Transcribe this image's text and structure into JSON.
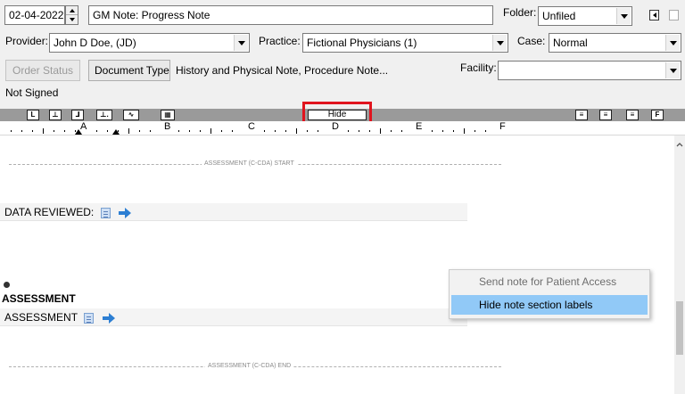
{
  "header": {
    "date": "02-04-2022",
    "note_title": "GM Note: Progress Note",
    "folder_label": "Folder:",
    "folder_value": "Unfiled",
    "provider_label": "Provider:",
    "provider_value": "John D Doe, (JD)",
    "practice_label": "Practice:",
    "practice_value": "Fictional Physicians (1)",
    "case_label": "Case:",
    "case_value": "Normal",
    "order_status_label": "Order Status",
    "document_type_label": "Document Type",
    "document_type_value": "History and Physical Note, Procedure Note...",
    "facility_label": "Facility:",
    "facility_value": "",
    "sign_status": "Not Signed"
  },
  "toolbar": {
    "hide_label": "Hide",
    "right_btn_f": "F"
  },
  "ruler": {
    "marks": [
      "A",
      "B",
      "C",
      "D",
      "E",
      "F"
    ]
  },
  "document": {
    "start_label": "ASSESSMENT (C-CDA) START",
    "data_reviewed_label": "DATA REVIEWED:",
    "section_heading": "ASSESSMENT",
    "assessment_label": "ASSESSMENT",
    "end_label": "ASSESSMENT (C-CDA) END"
  },
  "context_menu": {
    "items": [
      "Send note for Patient Access",
      "Hide note section labels"
    ]
  },
  "colors": {
    "highlight_box": "#e0141e",
    "menu_selected": "#91c9f7",
    "arrow_icon": "#2d7fd3"
  }
}
